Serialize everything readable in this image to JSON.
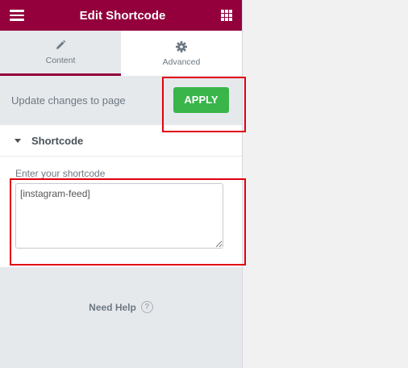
{
  "header": {
    "title": "Edit Shortcode"
  },
  "tabs": [
    {
      "label": "Content",
      "icon": "pencil-icon",
      "active": true
    },
    {
      "label": "Advanced",
      "icon": "gear-icon",
      "active": false
    }
  ],
  "update": {
    "text": "Update changes to page",
    "apply_label": "APPLY"
  },
  "section": {
    "title": "Shortcode"
  },
  "control": {
    "label": "Enter your shortcode",
    "value": "[instagram-feed]"
  },
  "help": {
    "text": "Need Help",
    "icon_glyph": "?"
  },
  "colors": {
    "header": "#93003c",
    "apply": "#39b54a",
    "highlight": "#e0000f"
  }
}
